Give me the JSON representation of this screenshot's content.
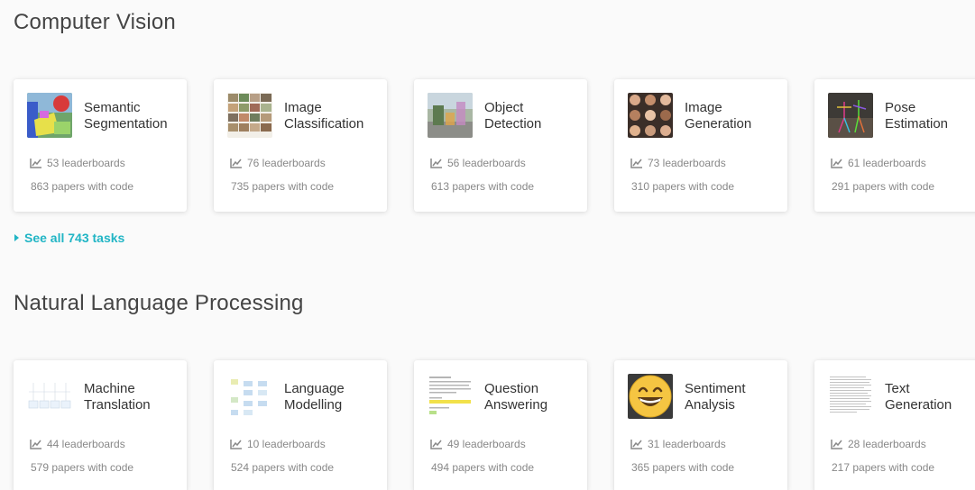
{
  "sections": [
    {
      "title": "Computer Vision",
      "see_all": "See all 743 tasks",
      "cards": [
        {
          "name_line1": "Semantic",
          "name_line2": "Segmentation",
          "leaderboards": "53 leaderboards",
          "papers": "863 papers with code",
          "icon": "segmentation-thumbnail"
        },
        {
          "name_line1": "Image",
          "name_line2": "Classification",
          "leaderboards": "76 leaderboards",
          "papers": "735 papers with code",
          "icon": "image-grid-thumbnail"
        },
        {
          "name_line1": "Object",
          "name_line2": "Detection",
          "leaderboards": "56 leaderboards",
          "papers": "613 papers with code",
          "icon": "street-scene-thumbnail"
        },
        {
          "name_line1": "Image",
          "name_line2": "Generation",
          "leaderboards": "73 leaderboards",
          "papers": "310 papers with code",
          "icon": "faces-grid-thumbnail"
        },
        {
          "name_line1": "Pose",
          "name_line2": "Estimation",
          "leaderboards": "61 leaderboards",
          "papers": "291 papers with code",
          "icon": "pose-skeleton-thumbnail"
        }
      ]
    },
    {
      "title": "Natural Language Processing",
      "cards": [
        {
          "name_line1": "Machine",
          "name_line2": "Translation",
          "leaderboards": "44 leaderboards",
          "papers": "579 papers with code",
          "icon": "diagram-thumbnail"
        },
        {
          "name_line1": "Language",
          "name_line2": "Modelling",
          "leaderboards": "10 leaderboards",
          "papers": "524 papers with code",
          "icon": "blocks-diagram-thumbnail"
        },
        {
          "name_line1": "Question",
          "name_line2": "Answering",
          "leaderboards": "49 leaderboards",
          "papers": "494 papers with code",
          "icon": "highlighted-text-thumbnail"
        },
        {
          "name_line1": "Sentiment",
          "name_line2": "Analysis",
          "leaderboards": "31 leaderboards",
          "papers": "365 papers with code",
          "icon": "smiley-emoji-thumbnail"
        },
        {
          "name_line1": "Text",
          "name_line2": "Generation",
          "leaderboards": "28 leaderboards",
          "papers": "217 papers with code",
          "icon": "text-document-thumbnail"
        }
      ]
    }
  ],
  "colors": {
    "accent": "#21b5c5",
    "muted_text": "#888888",
    "card_bg": "#ffffff",
    "page_bg": "#fafafa"
  }
}
